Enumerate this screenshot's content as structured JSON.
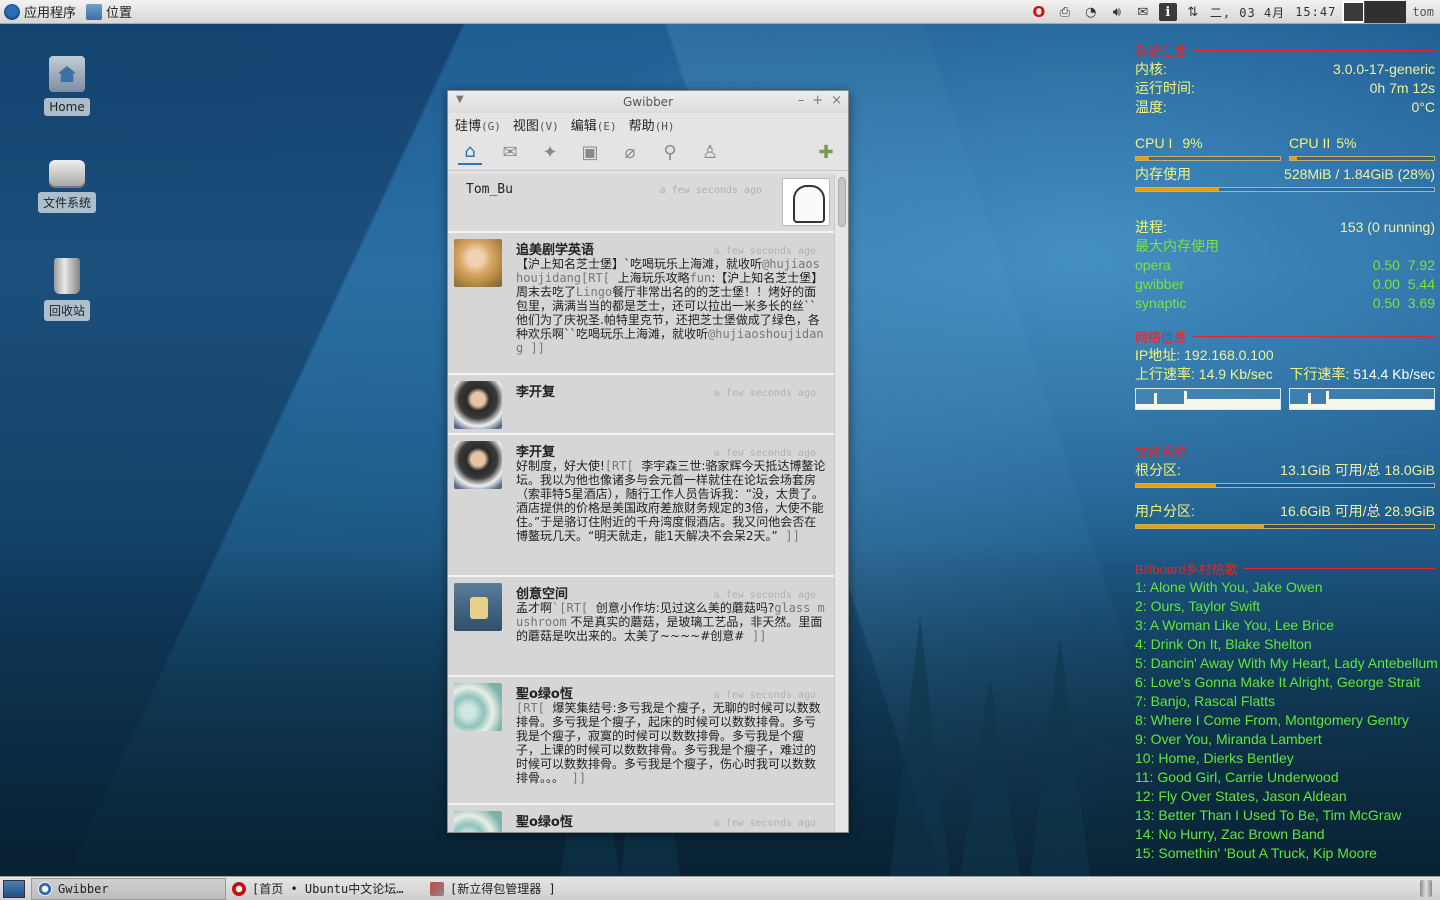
{
  "top_panel": {
    "applications": "应用程序",
    "places": "位置",
    "date": "二, 03  4月",
    "time": "15:47",
    "user": "tom"
  },
  "desktop_icons": [
    {
      "label": "Home",
      "icon": "home-folder-icon"
    },
    {
      "label": "文件系统",
      "icon": "hard-drive-icon"
    },
    {
      "label": "回收站",
      "icon": "trash-icon"
    }
  ],
  "gwibber": {
    "title": "Gwibber",
    "menu": [
      {
        "label": "硅博",
        "accel": "(G)"
      },
      {
        "label": "视图",
        "accel": "(V)"
      },
      {
        "label": "编辑",
        "accel": "(E)"
      },
      {
        "label": "帮助",
        "accel": "(H)"
      }
    ],
    "toolbar_icons": [
      "home-icon",
      "messages-icon",
      "replies-icon",
      "private-icon",
      "attachment-icon",
      "search-icon",
      "user-icon",
      "compose-icon"
    ],
    "self_post": {
      "name": "Tom_Bu",
      "time": "a few seconds ago"
    },
    "posts": [
      {
        "name": "追美剧学英语",
        "time": "a few seconds ago",
        "text": "【沪上知名芝士堡】`吃喝玩乐上海滩，就收听",
        "muted": "@hujiaoshoujidang[RT[",
        "text2": "上海玩乐攻略",
        "muted2": "fun",
        "text3": ":【沪上知名芝士堡】周末去吃了",
        "muted3": "Lingo",
        "text4": "餐厅非常出名的的芝士堡！！烤好的面包里，满满当当的都是芝士，还可以拉出一米多长的丝``他们为了庆祝圣.帕特里克节，还把芝士堡做成了绿色，各种欢乐啊``吃喝玩乐上海滩，就收听",
        "muted4": "@hujiaoshoujidang  ]]"
      },
      {
        "name": "李开复",
        "time": "a few seconds ago"
      },
      {
        "name": "李开复",
        "time": "a few seconds ago",
        "text": "好制度，好大使!",
        "muted": "[RT[",
        "text2": "李宇森三世:骆家辉今天抵达博鳌论坛。我以为他也像诸多与会元首一样就住在论坛会场套房（索菲特5星酒店），随行工作人员告诉我：“没，太贵了。酒店提供的价格是美国政府差旅财务规定的3倍，大使不能住。”于是骆订住附近的千舟湾度假酒店。我又问他会否在博鳌玩几天。“明天就走，能1天解决不会呆2天。”",
        "muted2": "]]"
      },
      {
        "name": "创意空间",
        "time": "a few seconds ago",
        "text": "孟才啊",
        "muted": "`[RT[",
        "text2": "创意小作坊:见过这么美的蘑菇吗?",
        "muted2": "glass mushroom",
        "text3": "不是真实的蘑菇，是玻璃工艺品，非天然。里面的蘑菇是吹出来的。太美了~~~~#创意#",
        "muted3": "]]"
      },
      {
        "name": "聖o绿o恆",
        "time": "a few seconds ago",
        "muted": "[RT[",
        "text": "爆笑集结号:多亏我是个瘦子，无聊的时候可以数数排骨。多亏我是个瘦子，起床的时候可以数数排骨。多亏我是个瘦子，寂寞的时候可以数数排骨。多亏我是个瘦子，上课的时候可以数数排骨。多亏我是个瘦子，难过的时候可以数数排骨。多亏我是个瘦子，伤心时我可以数数排骨。。。",
        "muted2": "]]"
      },
      {
        "name": "聖o绿o恆",
        "time": "a few seconds ago"
      }
    ]
  },
  "conky": {
    "system_header": "系统信息",
    "kernel_label": "内核:",
    "kernel_value": "3.0.0-17-generic",
    "uptime_label": "运行时间:",
    "uptime_value": "0h 7m 12s",
    "temp_label": "温度:",
    "temp_value": "0°C",
    "cpu1_label": "CPU I",
    "cpu1_value": "9%",
    "cpu1_level": 0.09,
    "cpu2_label": "CPU II",
    "cpu2_value": "5%",
    "cpu2_level": 0.05,
    "mem_label": "内存使用",
    "mem_value": "528MiB / 1.84GiB (28%)",
    "mem_level": 0.28,
    "proc_label": "进程:",
    "proc_value": "153 (0 running)",
    "top_mem_label": "最大内存使用",
    "top_processes": [
      {
        "name": "opera",
        "cpu": "0.50",
        "mem": "7.92"
      },
      {
        "name": "gwibber",
        "cpu": "0.00",
        "mem": "5.44"
      },
      {
        "name": "synaptic",
        "cpu": "0.50",
        "mem": "3.69"
      }
    ],
    "net_header": "网络信息",
    "ip_label": "IP地址:",
    "ip_value": "192.168.0.100",
    "up_label": "上行速率:",
    "up_value": "14.9 Kb/sec",
    "down_label": "下行速率:",
    "down_value": "514.4 Kb/sec",
    "fs_header": "文件系统",
    "root_label": "根分区:",
    "root_value": "13.1GiB 可用/总 18.0GiB",
    "root_level": 0.27,
    "home_label": "用户分区:",
    "home_value": "16.6GiB 可用/总 28.9GiB",
    "home_level": 0.43,
    "billboard_header": "Billboard乡村热歌",
    "songs": [
      "1: Alone With You, Jake Owen",
      "2: Ours, Taylor Swift",
      "3: A Woman Like You, Lee Brice",
      "4: Drink On It, Blake Shelton",
      "5: Dancin' Away With My Heart, Lady Antebellum",
      "6: Love's Gonna Make It Alright, George Strait",
      "7: Banjo, Rascal Flatts",
      "8: Where I Come From, Montgomery Gentry",
      "9: Over You, Miranda Lambert",
      "10: Home, Dierks Bentley",
      "11: Good Girl, Carrie Underwood",
      "12: Fly Over States, Jason Aldean",
      "13: Better Than I Used To Be, Tim McGraw",
      "14: No Hurry, Zac Brown Band",
      "15: Somethin' 'Bout A Truck, Kip Moore"
    ]
  },
  "taskbar": {
    "tasks": [
      {
        "label": "Gwibber",
        "icon": "gwibber-icon",
        "active": true
      },
      {
        "label": "[首页 • Ubuntu中文论坛…",
        "icon": "opera-icon",
        "active": false
      },
      {
        "label": "[新立得包管理器 ]",
        "icon": "package-icon",
        "active": false
      }
    ]
  },
  "colors": {
    "conky_red": "#ee2222",
    "conky_yellow": "#f3f37a",
    "conky_green": "#76ee2a",
    "bar_fill": "#e8a010"
  }
}
